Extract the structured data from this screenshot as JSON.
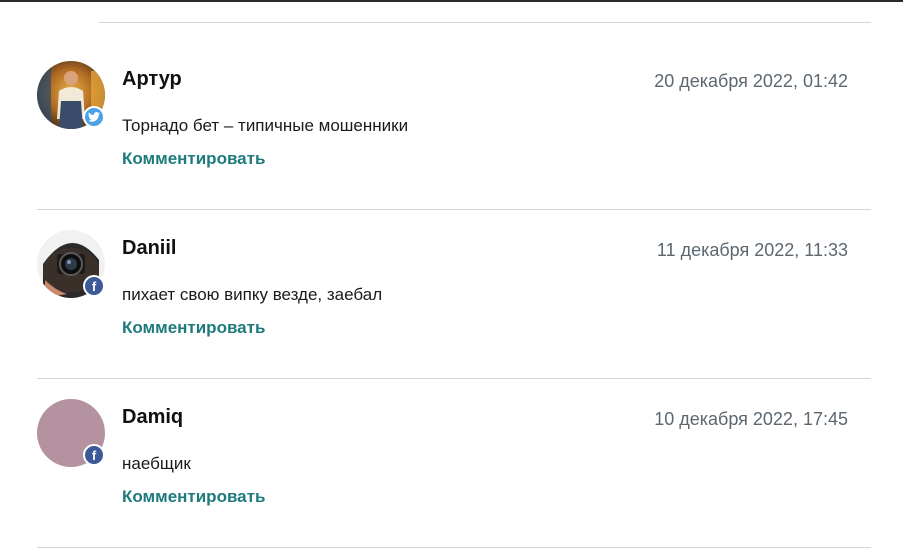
{
  "comments": [
    {
      "author": "Артур",
      "date": "20 декабря 2022, 01:42",
      "text": "Торнадо бет – типичные мошенники",
      "reply_label": "Комментировать",
      "social": "twitter",
      "badge_glyph": "🐦",
      "avatar_kind": "photo-person"
    },
    {
      "author": "Daniil",
      "date": "11 декабря 2022, 11:33",
      "text": "пихает свою випку везде, заебал",
      "reply_label": "Комментировать",
      "social": "facebook",
      "badge_glyph": "f",
      "avatar_kind": "photo-camera"
    },
    {
      "author": "Damiq",
      "date": "10 декабря 2022, 17:45",
      "text": "наебщик",
      "reply_label": "Комментировать",
      "social": "facebook",
      "badge_glyph": "f",
      "avatar_kind": "placeholder"
    }
  ],
  "colors": {
    "accent_link": "#1f7a7c",
    "date_text": "#5c6770",
    "divider": "#d4d4d4",
    "twitter": "#4ba2e6",
    "facebook": "#3d5a98",
    "placeholder_avatar": "#b592a0"
  }
}
